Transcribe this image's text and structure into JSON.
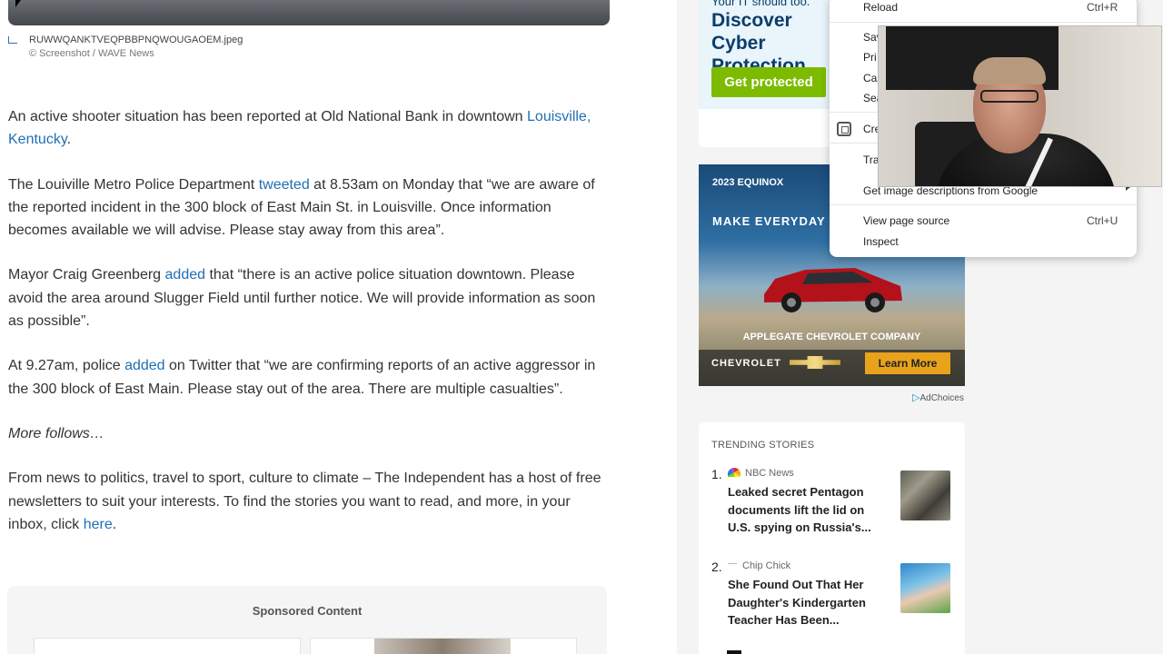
{
  "article": {
    "caption_filename": "RUWWQANKTVEQPBBPNQWOUGAOEM.jpeg",
    "caption_credit": "© Screenshot / WAVE News",
    "p1_text": "An active shooter situation has been reported at Old National Bank in downtown ",
    "p1_link1": "Louisville,",
    "p1_link2": "Kentucky",
    "p1_end": ".",
    "p2_start": "The Louiville Metro Police Department ",
    "p2_link": "tweeted",
    "p2_end": " at 8.53am on Monday that “we are aware of the reported incident in the 300 block of East Main St. in Louisville. Once information becomes available we will advise. Please stay away from this area”.",
    "p3_start": "Mayor Craig Greenberg ",
    "p3_link": "added",
    "p3_end": " that “there is an active police situation downtown. Please avoid the area around Slugger Field until further notice. We will provide information as soon as possible”.",
    "p4_start": "At 9.27am, police ",
    "p4_link": "added",
    "p4_end": " on Twitter that “we are confirming reports of an active aggressor in the 300 block of East Main. Please stay out of the area. There are multiple casualties”.",
    "p5": "More follows…",
    "p6_start": "From news to politics, travel to sport, culture to climate – The Independent has a host of free newsletters to suit your interests. To find the stories you want to read, and more, in your inbox, click ",
    "p6_link": "here",
    "p6_end": "."
  },
  "sponsored": {
    "title": "Sponsored Content"
  },
  "ad_top": {
    "small": "Your IT should too.",
    "headline": "Discover Cyber Protection",
    "button": "Get protected",
    "colors": {
      "button": "#7cbb00",
      "headline": "#0b3d6b"
    }
  },
  "ad_car": {
    "year": "2023 EQUINOX",
    "tagline": "MAKE EVERYDAY A",
    "dealer": "APPLEGATE CHEVROLET COMPANY",
    "brand": "CHEVROLET",
    "button": "Learn More",
    "adchoices": "AdChoices"
  },
  "trending": {
    "header": "TRENDING STORIES",
    "stories": [
      {
        "num": "1.",
        "source": "NBC News",
        "title": "Leaked secret Pentagon documents lift the lid on U.S. spying on Russia's..."
      },
      {
        "num": "2.",
        "source": "Chip Chick",
        "title": "She Found Out That Her Daughter's Kindergarten Teacher Has Been..."
      }
    ]
  },
  "context_menu": {
    "items": [
      {
        "label": "Reload",
        "shortcut": "Ctrl+R"
      },
      {
        "label": "Sav",
        "shortcut": ""
      },
      {
        "label": "Pri",
        "shortcut": ""
      },
      {
        "label": "Cas",
        "shortcut": ""
      },
      {
        "label": "Sea",
        "shortcut": ""
      },
      {
        "label": "Cre",
        "shortcut": ""
      },
      {
        "label": "Tra",
        "shortcut": ""
      },
      {
        "label": "Get image descriptions from Google",
        "shortcut": ""
      },
      {
        "label": "View page source",
        "shortcut": "Ctrl+U"
      },
      {
        "label": "Inspect",
        "shortcut": ""
      }
    ]
  }
}
